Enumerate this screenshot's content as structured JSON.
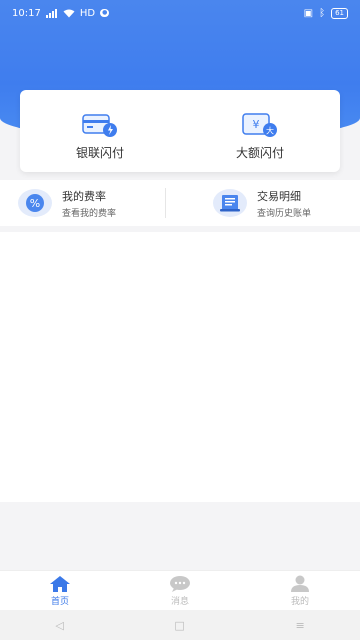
{
  "status_bar": {
    "time": "10:17",
    "network": "HD",
    "battery": "61"
  },
  "services": [
    {
      "label": "银联闪付",
      "icon": "unionpay-card-icon"
    },
    {
      "label": "大额闪付",
      "icon": "large-payment-icon"
    }
  ],
  "fees": [
    {
      "title": "我的费率",
      "subtitle": "查看我的费率",
      "icon": "percent-icon"
    },
    {
      "title": "交易明细",
      "subtitle": "查询历史账单",
      "icon": "bill-icon"
    }
  ],
  "tabs": [
    {
      "label": "首页",
      "active": true,
      "icon": "home-icon"
    },
    {
      "label": "消息",
      "active": false,
      "icon": "message-icon"
    },
    {
      "label": "我的",
      "active": false,
      "icon": "profile-icon"
    }
  ],
  "colors": {
    "primary": "#3f7dee",
    "active_tab": "#3b79e8",
    "inactive_tab": "#bbbbbb"
  }
}
